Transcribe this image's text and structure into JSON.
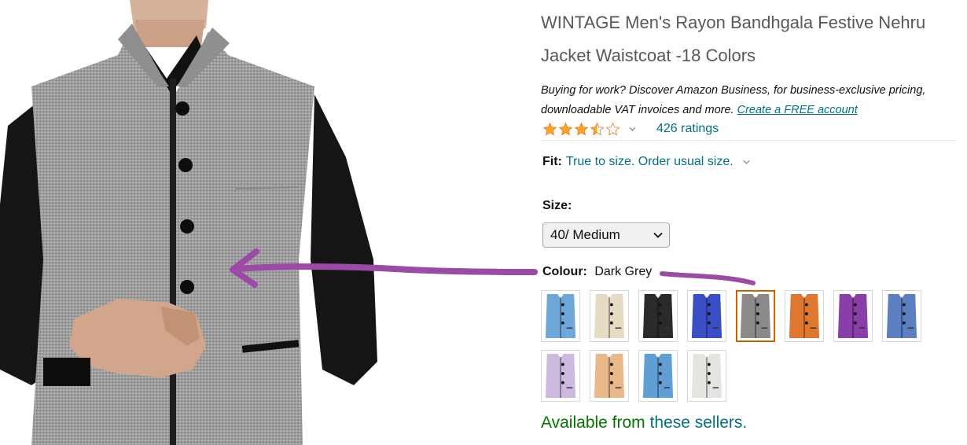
{
  "product": {
    "title": "WINTAGE Men's Rayon Bandhgala Festive Nehru Jacket Waistcoat -18 Colors"
  },
  "business_promo": {
    "text": "Buying for work? Discover Amazon Business, for business-exclusive pricing, downloadable VAT invoices and more. ",
    "link_label": "Create a FREE account"
  },
  "rating": {
    "stars": 3.5,
    "ratings_label": "426 ratings"
  },
  "fit": {
    "label": "Fit:",
    "value": "True to size. Order usual size."
  },
  "size": {
    "label": "Size:",
    "selected": "40/ Medium"
  },
  "colour": {
    "label": "Colour:",
    "selected": "Dark Grey",
    "swatches": [
      {
        "name": "light-blue",
        "color": "#6ea8d8"
      },
      {
        "name": "cream",
        "color": "#e6dcc3"
      },
      {
        "name": "black",
        "color": "#2a2a2a"
      },
      {
        "name": "royal-blue",
        "color": "#3a4fc6"
      },
      {
        "name": "dark-grey",
        "color": "#8a8a8a",
        "selected": true
      },
      {
        "name": "orange",
        "color": "#e0772e"
      },
      {
        "name": "purple",
        "color": "#8a3ea8"
      },
      {
        "name": "denim-blue",
        "color": "#5b7fc0"
      },
      {
        "name": "lavender",
        "color": "#cbb9de"
      },
      {
        "name": "peach",
        "color": "#eab98a"
      },
      {
        "name": "sky-blue",
        "color": "#5f9fd6"
      },
      {
        "name": "off-white",
        "color": "#e4e4e0"
      }
    ]
  },
  "availability": {
    "prefix": "Available from ",
    "link_label": "these sellers."
  },
  "colors": {
    "link": "#007185",
    "available": "#007600",
    "star": "#ffa41c",
    "annotation": "#9b4aa6"
  }
}
